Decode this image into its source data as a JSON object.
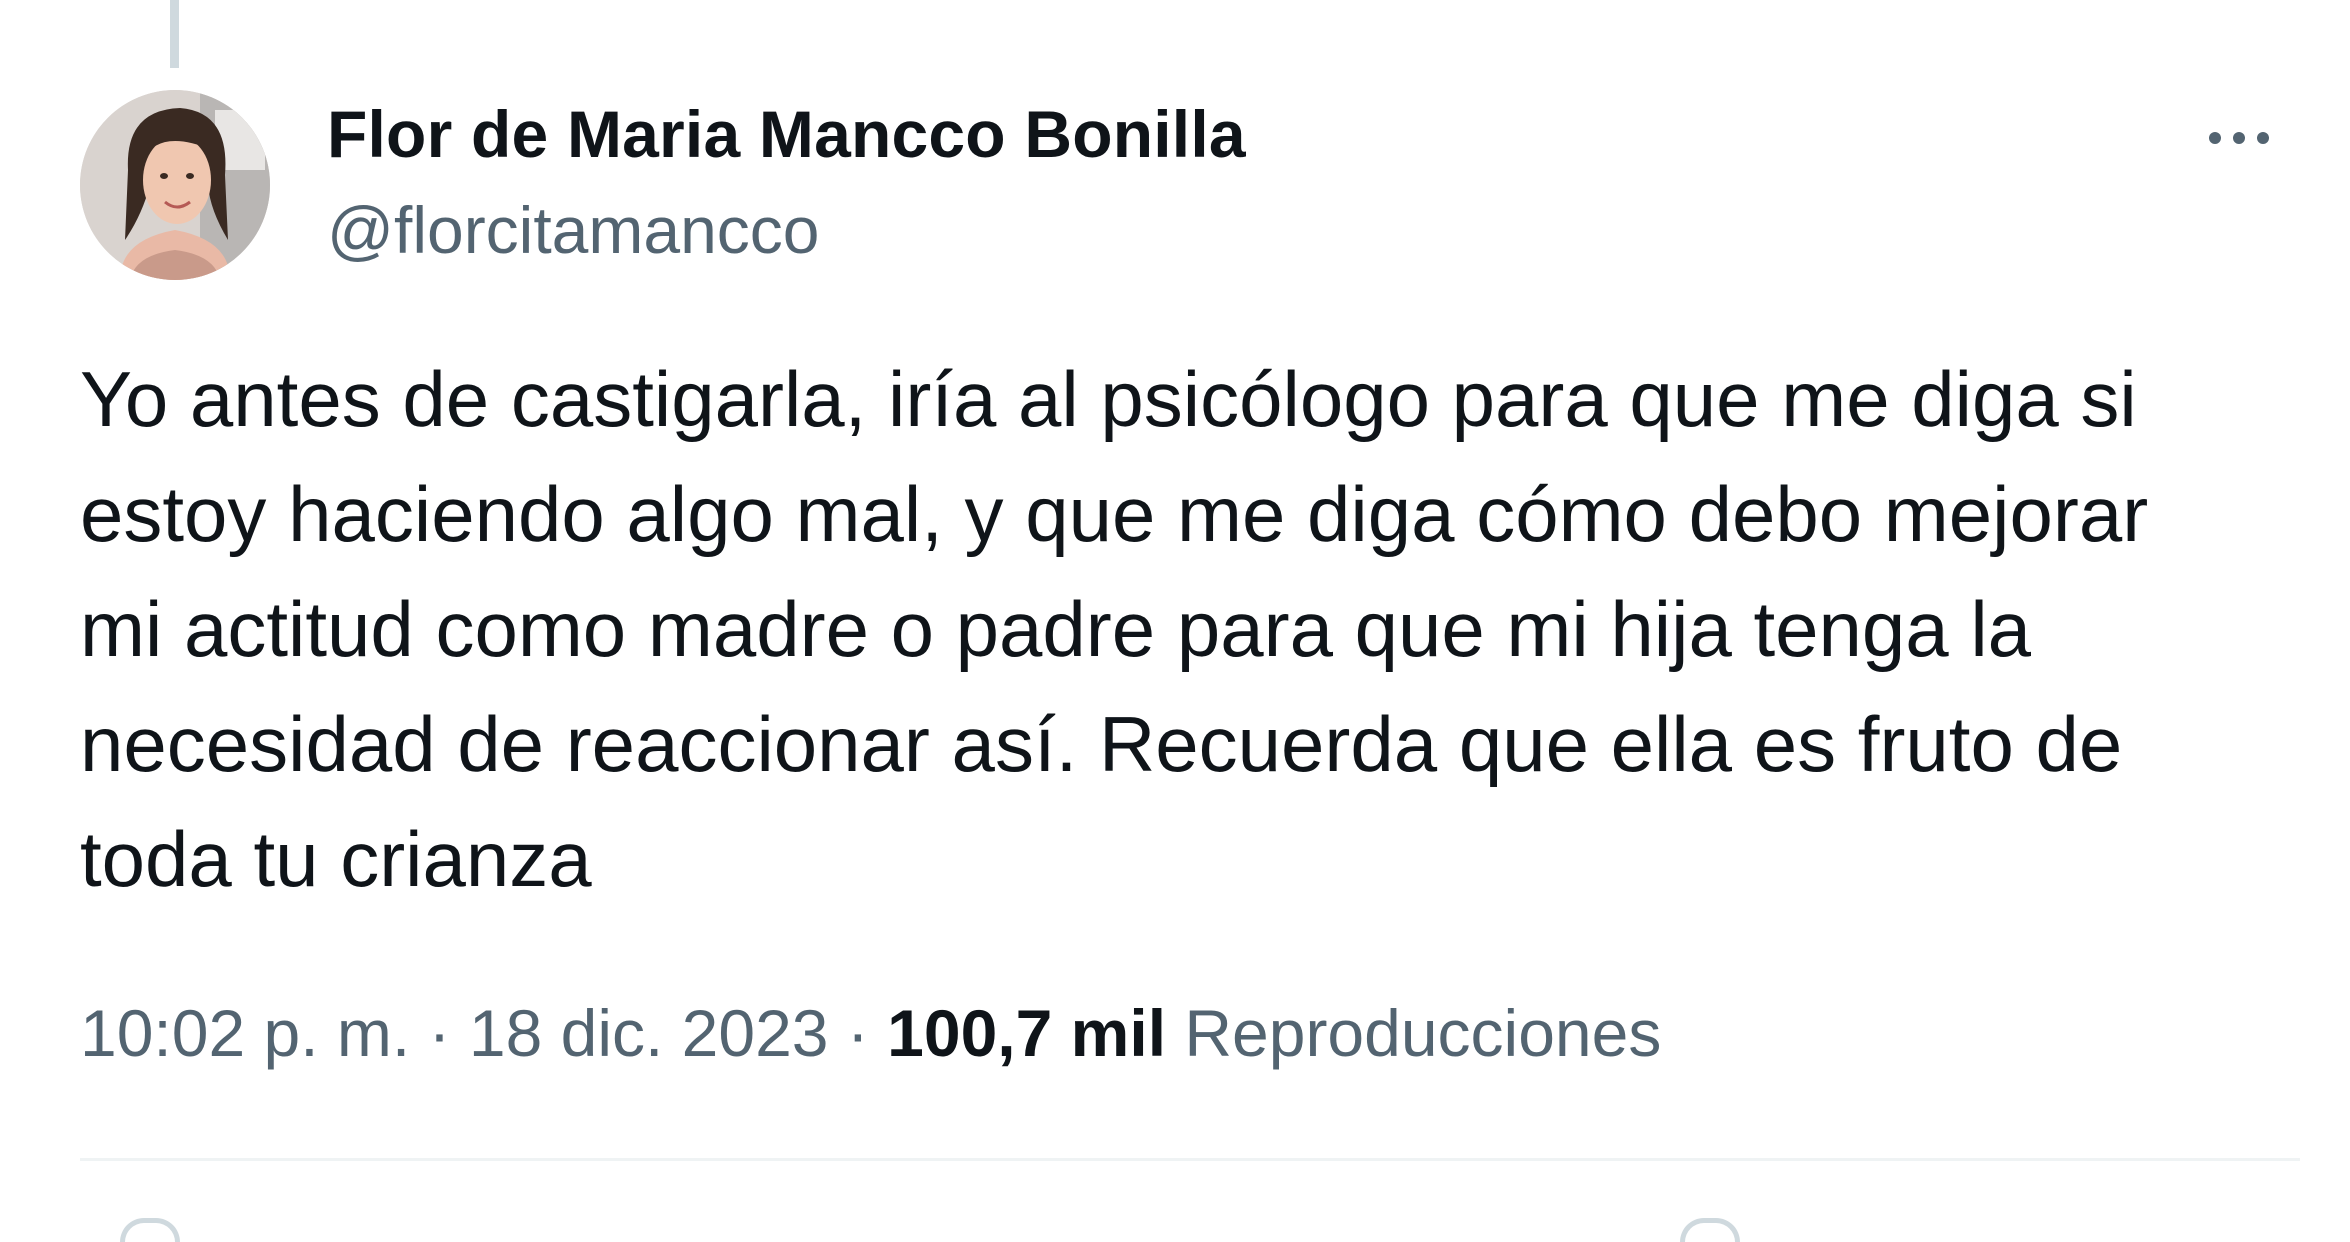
{
  "tweet": {
    "author": {
      "display_name": "Flor de Maria Mancco Bonilla",
      "handle": "@florcitamancco"
    },
    "text_lines": [
      "Yo antes de castigarla, iría al psicólogo para que me diga si",
      "estoy haciendo algo mal, y que me diga cómo debo mejorar",
      "mi actitud como madre o padre para que mi hija tenga la",
      "necesidad de reaccionar así. Recuerda que ella es fruto de",
      "toda tu crianza"
    ],
    "meta": {
      "time": "10:02 p. m.",
      "separator": "·",
      "date": "18 dic. 2023",
      "views_count": "100,7 mil",
      "views_label": "Reproducciones"
    },
    "icons": {
      "more": "more-horizontal-icon"
    }
  },
  "colors": {
    "text_primary": "#0f1419",
    "text_secondary": "#536471",
    "divider": "#eff3f4",
    "thread_line": "#cfd9de"
  }
}
